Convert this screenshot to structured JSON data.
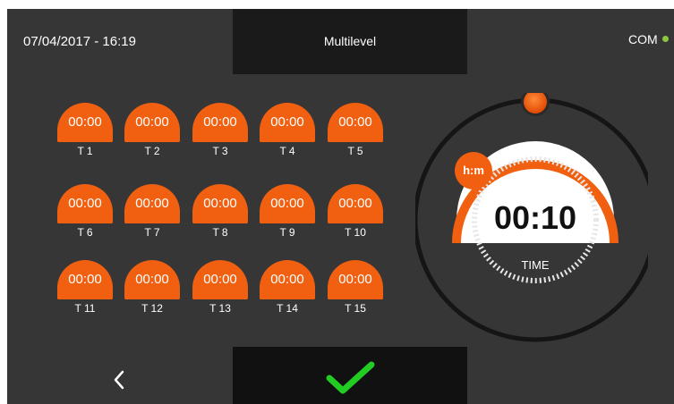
{
  "header": {
    "datetime": "07/04/2017 - 16:19",
    "title": "Multilevel",
    "com_label": "COM",
    "com_status_color": "#8cc63f"
  },
  "accent_color": "#f06010",
  "timers": [
    {
      "value": "00:00",
      "label": "T 1"
    },
    {
      "value": "00:00",
      "label": "T 2"
    },
    {
      "value": "00:00",
      "label": "T 3"
    },
    {
      "value": "00:00",
      "label": "T 4"
    },
    {
      "value": "00:00",
      "label": "T 5"
    },
    {
      "value": "00:00",
      "label": "T 6"
    },
    {
      "value": "00:00",
      "label": "T 7"
    },
    {
      "value": "00:00",
      "label": "T 8"
    },
    {
      "value": "00:00",
      "label": "T 9"
    },
    {
      "value": "00:00",
      "label": "T 10"
    },
    {
      "value": "00:00",
      "label": "T 11"
    },
    {
      "value": "00:00",
      "label": "T 12"
    },
    {
      "value": "00:00",
      "label": "T 13"
    },
    {
      "value": "00:00",
      "label": "T 14"
    },
    {
      "value": "00:00",
      "label": "T 15"
    }
  ],
  "dial": {
    "unit_badge": "h:m",
    "value": "00:10",
    "label": "TIME"
  },
  "footer": {
    "back_icon": "chevron-left-icon",
    "confirm_icon": "checkmark-icon",
    "confirm_color": "#22cc22"
  }
}
